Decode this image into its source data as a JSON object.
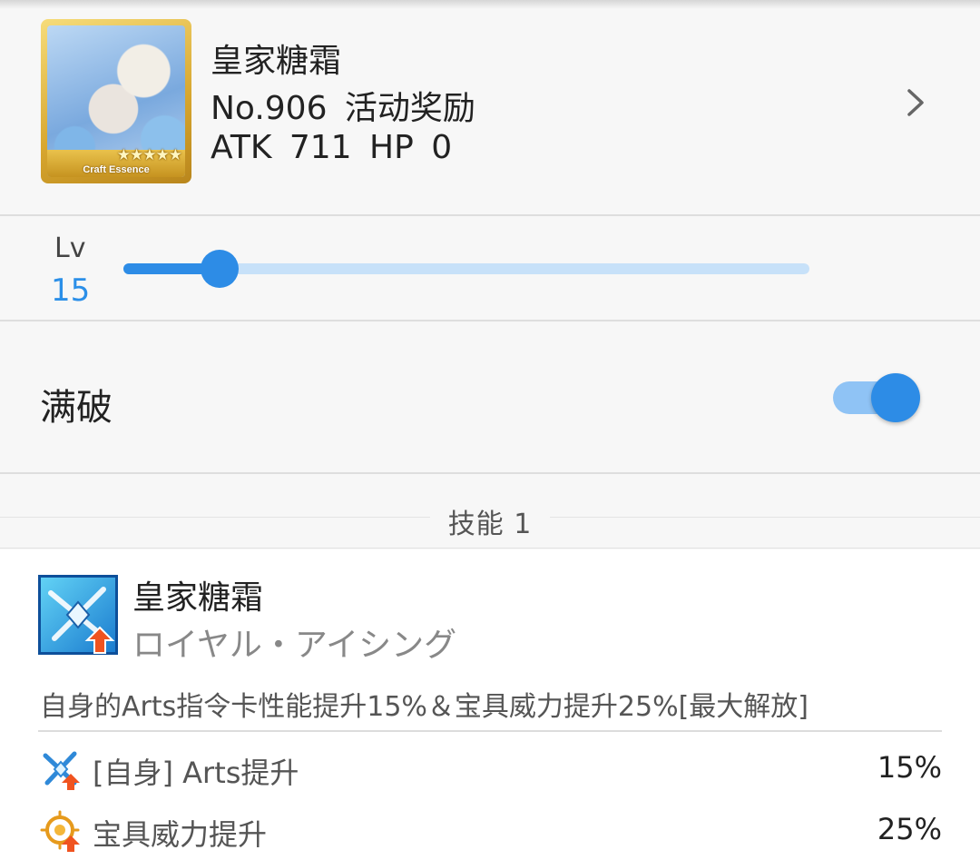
{
  "craft_essence": {
    "name": "皇家糖霜",
    "number_line": "No.906  活动奖励",
    "stats_line": "ATK 711  HP 0",
    "thumbnail": {
      "stars": "★★★★★",
      "caption": "Craft Essence"
    }
  },
  "level": {
    "caption": "Lv",
    "value": "15",
    "slider_fraction": 0.14
  },
  "max_limit_break": {
    "label": "满破",
    "enabled": true
  },
  "skill_section": {
    "title": "技能 1"
  },
  "skill": {
    "name": "皇家糖霜",
    "name_jp": "ロイヤル・アイシング",
    "description": "自身的Arts指令卡性能提升15%＆宝具威力提升25%[最大解放]",
    "effects": [
      {
        "icon": "arts-up-icon",
        "label": "[自身] Arts提升",
        "value": "15%"
      },
      {
        "icon": "np-damage-up-icon",
        "label": "宝具威力提升",
        "value": "25%"
      }
    ]
  },
  "colors": {
    "accent": "#2d8ce6",
    "accent_light": "#c7e1f9",
    "background": "#f7f7f7"
  }
}
